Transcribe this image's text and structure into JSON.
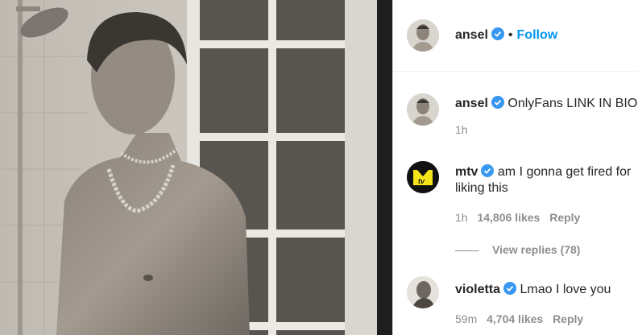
{
  "post": {
    "author": "ansel",
    "follow_label": "Follow",
    "separator": "•"
  },
  "comments": [
    {
      "username": "ansel",
      "text": "OnlyFans LINK IN BIO",
      "time": "1h",
      "avatar": "profile-photo"
    },
    {
      "username": "mtv",
      "text_line1": "am I gonna get fired for",
      "text_line2": "liking this",
      "time": "1h",
      "likes": "14,806 likes",
      "reply_label": "Reply",
      "view_replies": "View replies (78)",
      "avatar": "mtv-logo"
    },
    {
      "username": "violetta",
      "text": "Lmao I love you",
      "time": "59m",
      "likes": "4,704 likes",
      "reply_label": "Reply",
      "avatar": "profile-photo"
    }
  ],
  "colors": {
    "link_blue": "#0095f6",
    "verified_blue": "#3897f0",
    "text": "#262626",
    "muted": "#8e8e8e",
    "mtv_yellow": "#f5e41a"
  }
}
